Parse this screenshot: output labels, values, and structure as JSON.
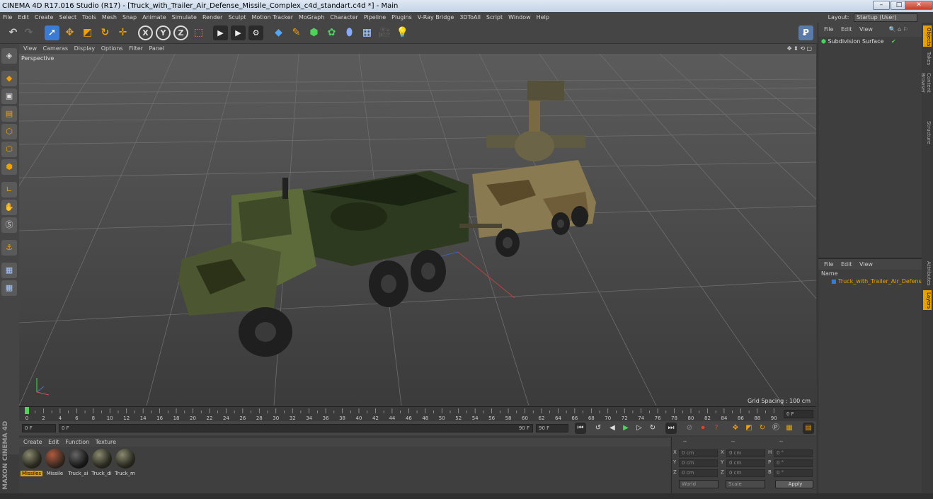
{
  "window": {
    "title": "CINEMA 4D R17.016 Studio (R17) - [Truck_with_Trailer_Air_Defense_Missile_Complex_c4d_standart.c4d *] - Main",
    "buttons": {
      "minimize": "–",
      "maximize": "□",
      "close": "✕"
    }
  },
  "menubar": {
    "items": [
      "File",
      "Edit",
      "Create",
      "Select",
      "Tools",
      "Mesh",
      "Snap",
      "Animate",
      "Simulate",
      "Render",
      "Sculpt",
      "Motion Tracker",
      "MoGraph",
      "Character",
      "Pipeline",
      "Plugins",
      "V-Ray Bridge",
      "3DToAll",
      "Script",
      "Window",
      "Help"
    ],
    "layout_label": "Layout:",
    "layout_value": "Startup (User)"
  },
  "viewport": {
    "menu": [
      "View",
      "Cameras",
      "Display",
      "Options",
      "Filter",
      "Panel"
    ],
    "camera_label": "Perspective",
    "grid_spacing": "Grid Spacing : 100 cm"
  },
  "timeline": {
    "ticks": [
      "0",
      "2",
      "4",
      "6",
      "8",
      "10",
      "12",
      "14",
      "16",
      "18",
      "20",
      "22",
      "24",
      "26",
      "28",
      "30",
      "32",
      "34",
      "36",
      "38",
      "40",
      "42",
      "44",
      "46",
      "48",
      "50",
      "52",
      "54",
      "56",
      "58",
      "60",
      "62",
      "64",
      "66",
      "68",
      "70",
      "72",
      "74",
      "76",
      "78",
      "80",
      "82",
      "84",
      "86",
      "88",
      "90"
    ],
    "end_field": "0 F"
  },
  "transport": {
    "current_frame": "0 F",
    "range_start": "0 F",
    "range_end": "90 F",
    "max_frame": "90 F"
  },
  "material_manager": {
    "menu": [
      "Create",
      "Edit",
      "Function",
      "Texture"
    ],
    "materials": [
      "Missiles",
      "Missile",
      "Truck_ai",
      "Truck_di",
      "Truck_m"
    ]
  },
  "coordinates": {
    "header": [
      "--",
      "--",
      "--"
    ],
    "rows": [
      {
        "a": "X",
        "av": "0 cm",
        "b": "X",
        "bv": "0 cm",
        "c": "H",
        "cv": "0 °"
      },
      {
        "a": "Y",
        "av": "0 cm",
        "b": "Y",
        "bv": "0 cm",
        "c": "P",
        "cv": "0 °"
      },
      {
        "a": "Z",
        "av": "0 cm",
        "b": "Z",
        "bv": "0 cm",
        "c": "B",
        "cv": "0 °"
      }
    ],
    "world": "World",
    "scale": "Scale",
    "apply": "Apply"
  },
  "object_manager": {
    "menu": [
      "File",
      "Edit",
      "View"
    ],
    "objects": [
      "Subdivision Surface"
    ]
  },
  "layer_manager": {
    "menu": [
      "File",
      "Edit",
      "View"
    ],
    "column": "Name",
    "layers": [
      "Truck_with_Trailer_Air_Defense_M"
    ]
  },
  "side_tabs": {
    "top": [
      "Objects",
      "Takes",
      "Content Browser",
      "Structure"
    ],
    "bottom": [
      "Attributes",
      "Layers"
    ]
  },
  "brand": "MAXON CINEMA 4D",
  "colors": {
    "accent_orange": "#e8a000",
    "selection_blue": "#3a7bd5"
  }
}
